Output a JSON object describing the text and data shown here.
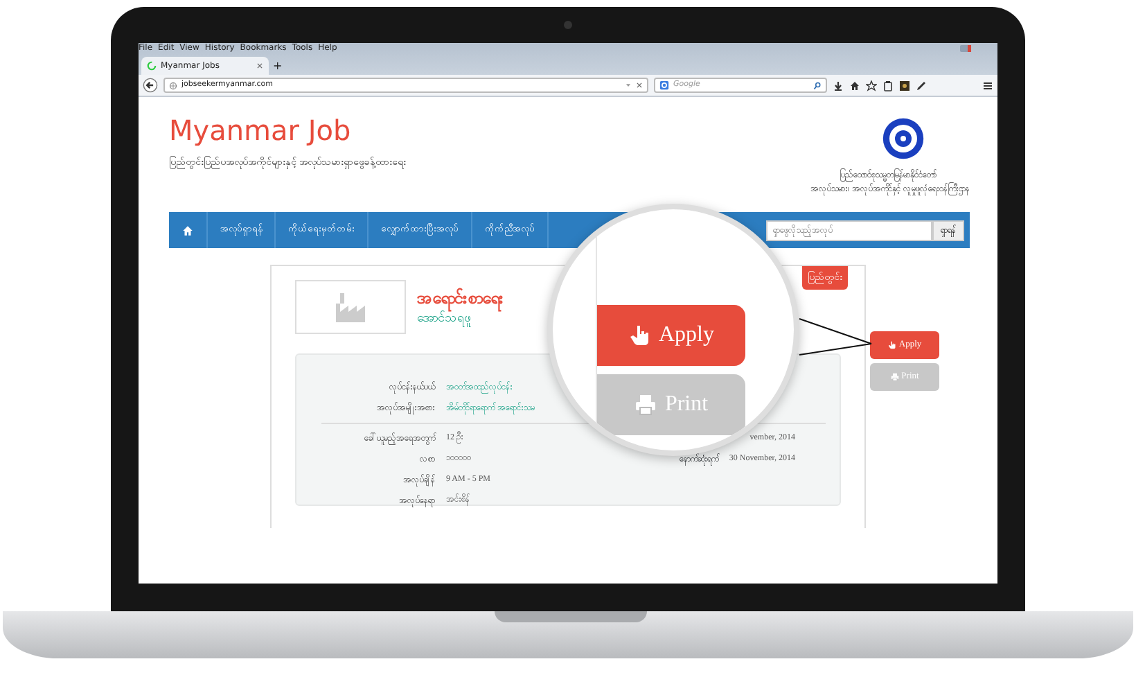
{
  "browser": {
    "menu": [
      "File",
      "Edit",
      "View",
      "History",
      "Bookmarks",
      "Tools",
      "Help"
    ],
    "tab": {
      "title": "Myanmar Jobs",
      "selected": true
    },
    "new_tab": "+",
    "url": "jobseekermyanmar.com",
    "search_placeholder": "Google"
  },
  "site": {
    "title": "Myanmar Job",
    "subtitle": "ပြည်တွင်းပြည်ပအလုပ်အကိုင်များနှင့် အလုပ်သမားရှာဖွေခန့်ထားရေး",
    "ministry": [
      "ပြည်ထောင်စုသမ္မတမြန်မာနိုင်ငံတော်",
      "အလုပ်သမား၊ အလုပ်အကိုင်နှင့် လူမှုဖူလုံရေးဝန်ကြီးဌာန"
    ]
  },
  "nav": {
    "items": [
      "အလုပ်ရှာရန်",
      "ကိုယ်ရေးမှတ်တမ်း",
      "လျှောက်ထားပြီးအလုပ်",
      "ကိုက်ညီအလုပ်"
    ],
    "search_placeholder": "ရှာဖွေလိုသည့်အလုပ်",
    "search_button": "ရှာရန်"
  },
  "job": {
    "badge": "ပြည်တွင်း",
    "title": "အရောင်းစာရေး",
    "company": "အောင်သရဖူ",
    "top_rows": [
      {
        "label": "လုပ်ငန်းနယ်ပယ်",
        "value": "အဝတ်အထည်လုပ်ငန်း"
      },
      {
        "label": "အလုပ်အမျိုးအစား",
        "value": "အိမ်တိုင်ရာရောက် အရောင်းသမ"
      }
    ],
    "rows": [
      {
        "label": "ခေါ်ယူမည့်အရေအတွက်",
        "value": "12 ဦး"
      },
      {
        "label": "လစာ",
        "value": "၁၀၀၀၀၀"
      },
      {
        "label": "အလုပ်ချိန်",
        "value": "9 AM - 5 PM"
      },
      {
        "label": "အလုပ်နေရာ",
        "value": "အင်းစိန်"
      }
    ],
    "dates": [
      {
        "value": "vember, 2014"
      },
      {
        "label": "နောက်ဆုံးရက်",
        "value": "30 November, 2014"
      }
    ]
  },
  "actions": [
    {
      "label": "Apply",
      "kind": "apply"
    },
    {
      "label": "Print",
      "kind": "print"
    }
  ],
  "magnifier": {
    "actions": [
      {
        "label": "Apply",
        "kind": "apply"
      },
      {
        "label": "Print",
        "kind": "print"
      }
    ]
  }
}
